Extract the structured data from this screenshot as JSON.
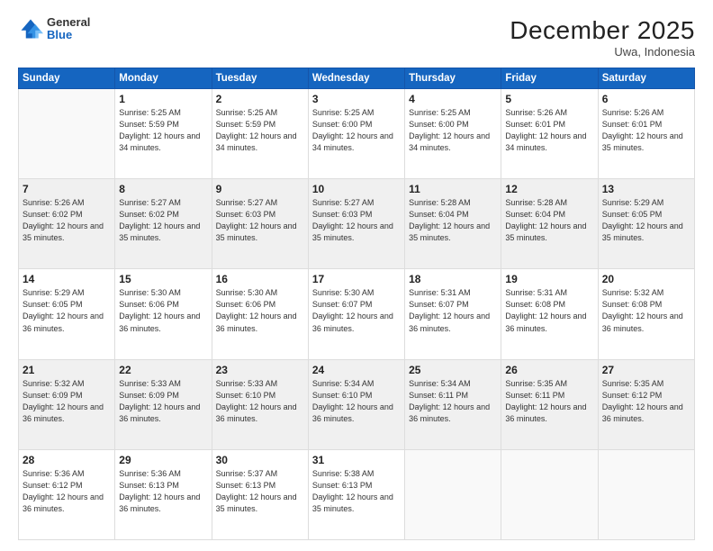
{
  "header": {
    "logo_general": "General",
    "logo_blue": "Blue",
    "month_title": "December 2025",
    "location": "Uwa, Indonesia"
  },
  "weekdays": [
    "Sunday",
    "Monday",
    "Tuesday",
    "Wednesday",
    "Thursday",
    "Friday",
    "Saturday"
  ],
  "weeks": [
    [
      {
        "day": "",
        "sunrise": "",
        "sunset": "",
        "daylight": ""
      },
      {
        "day": "1",
        "sunrise": "Sunrise: 5:25 AM",
        "sunset": "Sunset: 5:59 PM",
        "daylight": "Daylight: 12 hours and 34 minutes."
      },
      {
        "day": "2",
        "sunrise": "Sunrise: 5:25 AM",
        "sunset": "Sunset: 5:59 PM",
        "daylight": "Daylight: 12 hours and 34 minutes."
      },
      {
        "day": "3",
        "sunrise": "Sunrise: 5:25 AM",
        "sunset": "Sunset: 6:00 PM",
        "daylight": "Daylight: 12 hours and 34 minutes."
      },
      {
        "day": "4",
        "sunrise": "Sunrise: 5:25 AM",
        "sunset": "Sunset: 6:00 PM",
        "daylight": "Daylight: 12 hours and 34 minutes."
      },
      {
        "day": "5",
        "sunrise": "Sunrise: 5:26 AM",
        "sunset": "Sunset: 6:01 PM",
        "daylight": "Daylight: 12 hours and 34 minutes."
      },
      {
        "day": "6",
        "sunrise": "Sunrise: 5:26 AM",
        "sunset": "Sunset: 6:01 PM",
        "daylight": "Daylight: 12 hours and 35 minutes."
      }
    ],
    [
      {
        "day": "7",
        "sunrise": "Sunrise: 5:26 AM",
        "sunset": "Sunset: 6:02 PM",
        "daylight": "Daylight: 12 hours and 35 minutes."
      },
      {
        "day": "8",
        "sunrise": "Sunrise: 5:27 AM",
        "sunset": "Sunset: 6:02 PM",
        "daylight": "Daylight: 12 hours and 35 minutes."
      },
      {
        "day": "9",
        "sunrise": "Sunrise: 5:27 AM",
        "sunset": "Sunset: 6:03 PM",
        "daylight": "Daylight: 12 hours and 35 minutes."
      },
      {
        "day": "10",
        "sunrise": "Sunrise: 5:27 AM",
        "sunset": "Sunset: 6:03 PM",
        "daylight": "Daylight: 12 hours and 35 minutes."
      },
      {
        "day": "11",
        "sunrise": "Sunrise: 5:28 AM",
        "sunset": "Sunset: 6:04 PM",
        "daylight": "Daylight: 12 hours and 35 minutes."
      },
      {
        "day": "12",
        "sunrise": "Sunrise: 5:28 AM",
        "sunset": "Sunset: 6:04 PM",
        "daylight": "Daylight: 12 hours and 35 minutes."
      },
      {
        "day": "13",
        "sunrise": "Sunrise: 5:29 AM",
        "sunset": "Sunset: 6:05 PM",
        "daylight": "Daylight: 12 hours and 35 minutes."
      }
    ],
    [
      {
        "day": "14",
        "sunrise": "Sunrise: 5:29 AM",
        "sunset": "Sunset: 6:05 PM",
        "daylight": "Daylight: 12 hours and 36 minutes."
      },
      {
        "day": "15",
        "sunrise": "Sunrise: 5:30 AM",
        "sunset": "Sunset: 6:06 PM",
        "daylight": "Daylight: 12 hours and 36 minutes."
      },
      {
        "day": "16",
        "sunrise": "Sunrise: 5:30 AM",
        "sunset": "Sunset: 6:06 PM",
        "daylight": "Daylight: 12 hours and 36 minutes."
      },
      {
        "day": "17",
        "sunrise": "Sunrise: 5:30 AM",
        "sunset": "Sunset: 6:07 PM",
        "daylight": "Daylight: 12 hours and 36 minutes."
      },
      {
        "day": "18",
        "sunrise": "Sunrise: 5:31 AM",
        "sunset": "Sunset: 6:07 PM",
        "daylight": "Daylight: 12 hours and 36 minutes."
      },
      {
        "day": "19",
        "sunrise": "Sunrise: 5:31 AM",
        "sunset": "Sunset: 6:08 PM",
        "daylight": "Daylight: 12 hours and 36 minutes."
      },
      {
        "day": "20",
        "sunrise": "Sunrise: 5:32 AM",
        "sunset": "Sunset: 6:08 PM",
        "daylight": "Daylight: 12 hours and 36 minutes."
      }
    ],
    [
      {
        "day": "21",
        "sunrise": "Sunrise: 5:32 AM",
        "sunset": "Sunset: 6:09 PM",
        "daylight": "Daylight: 12 hours and 36 minutes."
      },
      {
        "day": "22",
        "sunrise": "Sunrise: 5:33 AM",
        "sunset": "Sunset: 6:09 PM",
        "daylight": "Daylight: 12 hours and 36 minutes."
      },
      {
        "day": "23",
        "sunrise": "Sunrise: 5:33 AM",
        "sunset": "Sunset: 6:10 PM",
        "daylight": "Daylight: 12 hours and 36 minutes."
      },
      {
        "day": "24",
        "sunrise": "Sunrise: 5:34 AM",
        "sunset": "Sunset: 6:10 PM",
        "daylight": "Daylight: 12 hours and 36 minutes."
      },
      {
        "day": "25",
        "sunrise": "Sunrise: 5:34 AM",
        "sunset": "Sunset: 6:11 PM",
        "daylight": "Daylight: 12 hours and 36 minutes."
      },
      {
        "day": "26",
        "sunrise": "Sunrise: 5:35 AM",
        "sunset": "Sunset: 6:11 PM",
        "daylight": "Daylight: 12 hours and 36 minutes."
      },
      {
        "day": "27",
        "sunrise": "Sunrise: 5:35 AM",
        "sunset": "Sunset: 6:12 PM",
        "daylight": "Daylight: 12 hours and 36 minutes."
      }
    ],
    [
      {
        "day": "28",
        "sunrise": "Sunrise: 5:36 AM",
        "sunset": "Sunset: 6:12 PM",
        "daylight": "Daylight: 12 hours and 36 minutes."
      },
      {
        "day": "29",
        "sunrise": "Sunrise: 5:36 AM",
        "sunset": "Sunset: 6:13 PM",
        "daylight": "Daylight: 12 hours and 36 minutes."
      },
      {
        "day": "30",
        "sunrise": "Sunrise: 5:37 AM",
        "sunset": "Sunset: 6:13 PM",
        "daylight": "Daylight: 12 hours and 35 minutes."
      },
      {
        "day": "31",
        "sunrise": "Sunrise: 5:38 AM",
        "sunset": "Sunset: 6:13 PM",
        "daylight": "Daylight: 12 hours and 35 minutes."
      },
      {
        "day": "",
        "sunrise": "",
        "sunset": "",
        "daylight": ""
      },
      {
        "day": "",
        "sunrise": "",
        "sunset": "",
        "daylight": ""
      },
      {
        "day": "",
        "sunrise": "",
        "sunset": "",
        "daylight": ""
      }
    ]
  ]
}
